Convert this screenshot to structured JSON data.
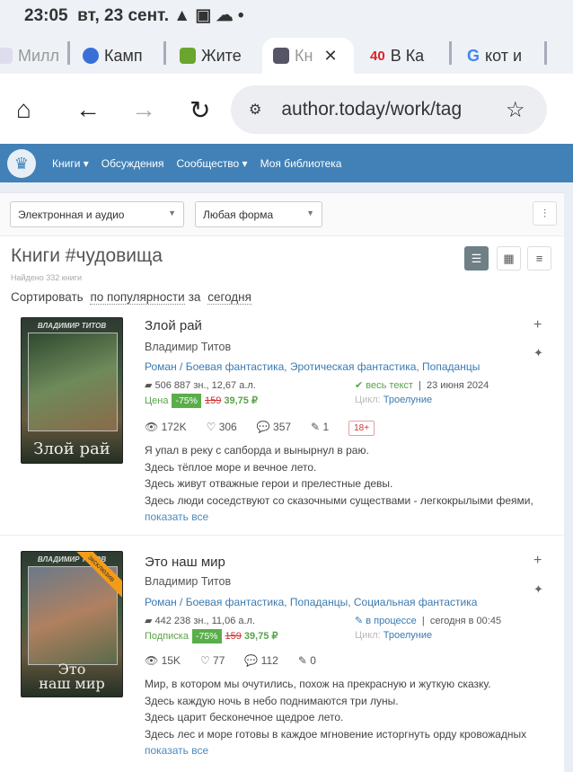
{
  "status": {
    "time": "23:05",
    "date": "вт, 23 сент."
  },
  "tabs": [
    {
      "label": "Милл"
    },
    {
      "label": "Камп"
    },
    {
      "label": "Жите"
    },
    {
      "label": "Кн",
      "active": true
    },
    {
      "label": "В Ка"
    },
    {
      "label": "кот и"
    }
  ],
  "toolbar": {
    "url": "author.today/work/tag"
  },
  "nav": {
    "items": [
      "Книги ▾",
      "Обсуждения",
      "Сообщество ▾",
      "Моя библиотека"
    ]
  },
  "filters": {
    "format": "Электронная и аудио",
    "form": "Любая форма"
  },
  "page": {
    "title": "Книги #чудовища",
    "found": "Найдено 332 книги",
    "sort_label": "Сортировать",
    "sort_by": "по популярности",
    "sort_for": "за",
    "sort_period": "сегодня"
  },
  "books": [
    {
      "title": "Злой рай",
      "author": "Владимир Титов",
      "cover_author": "ВЛАДИМИР ТИТОВ",
      "genres": "Роман / Боевая фантастика, Эротическая фантастика, Попаданцы",
      "size": "506 887 зн., 12,67 а.л.",
      "status": "весь текст",
      "date": "23 июня 2024",
      "price_label": "Цена",
      "discount": "-75%",
      "old_price": "159",
      "price": "39,75 ₽",
      "cycle_label": "Цикл:",
      "cycle": "Троелуние",
      "views": "172K",
      "likes": "306",
      "comments": "357",
      "awards": "1",
      "age": "18+",
      "annotation": [
        "Я упал в реку с сапборда и вынырнул в раю.",
        "Здесь тёплое море и вечное лето.",
        "Здесь живут отважные герои и прелестные девы.",
        "Здесь люди соседствуют со сказочными существами - легкокрылыми феями,"
      ],
      "more": "показать все"
    },
    {
      "title": "Это наш мир",
      "author": "Владимир Титов",
      "cover_author": "ВЛАДИМИР ТИТОВ",
      "exclusive": "эксклюзив",
      "genres": "Роман / Боевая фантастика, Попаданцы, Социальная фантастика",
      "size": "442 238 зн., 11,06 а.л.",
      "status": "в процессе",
      "date": "сегодня в 00:45",
      "price_label": "Подписка",
      "discount": "-75%",
      "old_price": "159",
      "price": "39,75 ₽",
      "cycle_label": "Цикл:",
      "cycle": "Троелуние",
      "views": "15K",
      "likes": "77",
      "comments": "112",
      "awards": "0",
      "annotation": [
        "Мир, в котором мы очутились, похож на прекрасную и жуткую сказку.",
        "Здесь каждую ночь в небо поднимаются три луны.",
        "Здесь царит бесконечное щедрое лето.",
        "Здесь лес и море готовы в каждое мгновение исторгнуть орду кровожадных"
      ],
      "more": "показать все"
    }
  ]
}
